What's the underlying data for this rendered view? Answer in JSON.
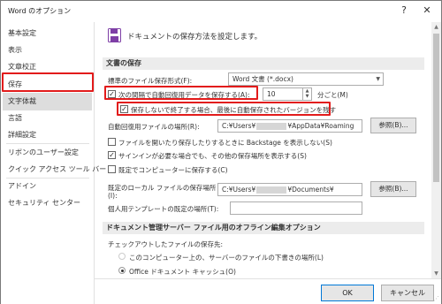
{
  "window": {
    "title": "Word のオプション",
    "help_glyph": "?",
    "close_glyph": "✕"
  },
  "sidebar": {
    "items": [
      {
        "label": "基本設定"
      },
      {
        "label": "表示"
      },
      {
        "label": "文章校正"
      },
      {
        "label": "保存",
        "selected": true
      },
      {
        "label": "文字体裁"
      },
      {
        "label": "言語"
      },
      {
        "label": "詳細設定"
      },
      {
        "label": "リボンのユーザー設定"
      },
      {
        "label": "クイック アクセス ツール バー"
      },
      {
        "label": "アドイン"
      },
      {
        "label": "セキュリティ センター"
      }
    ]
  },
  "main": {
    "heading": "ドキュメントの保存方法を設定します。",
    "save_section": {
      "title": "文書の保存",
      "format_label": "標準のファイル保存形式(F):",
      "format_value": "Word 文書 (*.docx)",
      "autorecover_label": "次の間隔で自動回復用データを保存する(A):",
      "autorecover_checked": true,
      "autorecover_minutes": "10",
      "minutes_suffix": "分ごと(M)",
      "keep_last_label": "保存しないで終了する場合、最後に自動保存されたバージョンを残す",
      "keep_last_checked": true,
      "autorecover_location_label": "自動回復用ファイルの場所(R):",
      "autorecover_path_prefix": "C:¥Users¥",
      "autorecover_path_suffix": "¥AppData¥Roaming",
      "browse_label_1": "参照(B)...",
      "backstage_label": "ファイルを開いたり保存したりするときに Backstage を表示しない(S)",
      "backstage_checked": false,
      "signin_label": "サインインが必要な場合でも、その他の保存場所を表示する(S)",
      "signin_checked": true,
      "default_local_label": "既定でコンピューターに保存する(C)",
      "default_local_checked": false,
      "local_location_label": "既定のローカル ファイルの保存場所",
      "local_location_label_2": "(I):",
      "local_path_prefix": "C:¥Users¥",
      "local_path_suffix": "¥Documents¥",
      "browse_label_2": "参照(B)...",
      "template_label": "個人用テンプレートの既定の場所(T):",
      "template_value": ""
    },
    "server_section": {
      "title": "ドキュメント管理サーバー ファイル用のオフライン編集オプション",
      "checkout_label": "チェックアウトしたファイルの保存先:",
      "option_server": "このコンピューター上の、サーバーのファイルの下書きの場所(L)",
      "option_cache": "Office ドキュメント キャッシュ(O)",
      "selected": "option_cache"
    }
  },
  "footer": {
    "ok_label": "OK",
    "cancel_label": "キャンセル"
  },
  "colors": {
    "highlight_red": "#e21b1b",
    "selection_gray": "#dddddd",
    "section_gray": "#ececec"
  }
}
